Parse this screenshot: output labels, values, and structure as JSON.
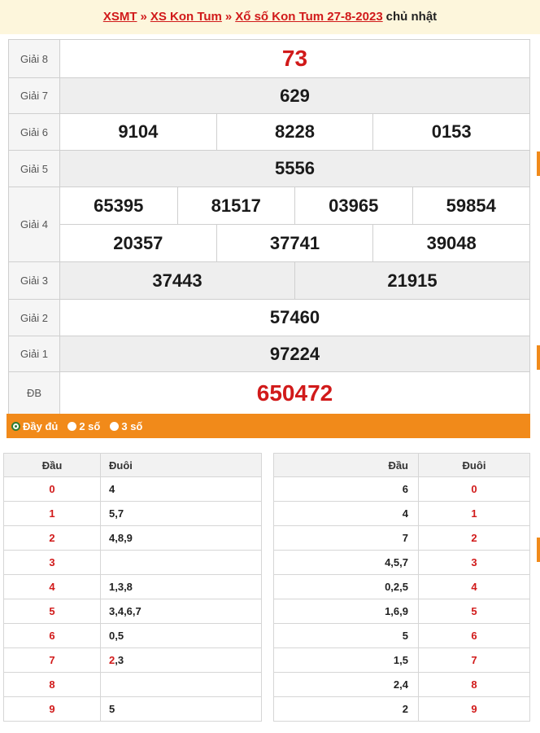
{
  "breadcrumb": {
    "xsmt": "XSMT",
    "sep": "»",
    "kontum": "XS Kon Tum",
    "result": "Xổ số Kon Tum 27-8-2023",
    "day": "chủ nhật"
  },
  "results": {
    "g8_label": "Giải 8",
    "g8": "73",
    "g7_label": "Giải 7",
    "g7": "629",
    "g6_label": "Giải 6",
    "g6": [
      "9104",
      "8228",
      "0153"
    ],
    "g5_label": "Giải 5",
    "g5": "5556",
    "g4_label": "Giải 4",
    "g4_row1": [
      "65395",
      "81517",
      "03965",
      "59854"
    ],
    "g4_row2": [
      "20357",
      "37741",
      "39048"
    ],
    "g3_label": "Giải 3",
    "g3": [
      "37443",
      "21915"
    ],
    "g2_label": "Giải 2",
    "g2": "57460",
    "g1_label": "Giải 1",
    "g1": "97224",
    "db_label": "ĐB",
    "db": "650472"
  },
  "display_options": {
    "full": "Đầy đủ",
    "two": "2 số",
    "three": "3 số"
  },
  "head_table": {
    "col_head": "Đầu",
    "col_tail": "Đuôi",
    "rows": [
      {
        "d": "0",
        "v": "4"
      },
      {
        "d": "1",
        "v": "5,7"
      },
      {
        "d": "2",
        "v": "4,8,9"
      },
      {
        "d": "3",
        "v": ""
      },
      {
        "d": "4",
        "v": "1,3,8"
      },
      {
        "d": "5",
        "v": "3,4,6,7"
      },
      {
        "d": "6",
        "v": "0,5"
      },
      {
        "d": "7",
        "v": "2,3"
      },
      {
        "d": "8",
        "v": ""
      },
      {
        "d": "9",
        "v": "5"
      }
    ]
  },
  "tail_table": {
    "col_head": "Đầu",
    "col_tail": "Đuôi",
    "rows": [
      {
        "v": "6",
        "d": "0"
      },
      {
        "v": "4",
        "d": "1"
      },
      {
        "v": "7",
        "d": "2"
      },
      {
        "v": "4,5,7",
        "d": "3"
      },
      {
        "v": "0,2,5",
        "d": "4"
      },
      {
        "v": "1,6,9",
        "d": "5"
      },
      {
        "v": "5",
        "d": "6"
      },
      {
        "v": "1,5",
        "d": "7"
      },
      {
        "v": "2,4",
        "d": "8"
      },
      {
        "v": "2",
        "d": "9"
      }
    ]
  },
  "colors": {
    "accent_red": "#d11a1a",
    "accent_orange": "#f18a1a",
    "header_bg": "#fdf6dc"
  }
}
